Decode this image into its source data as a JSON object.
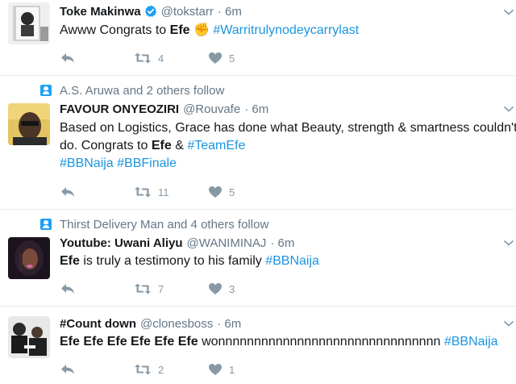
{
  "tweets": [
    {
      "name": "Toke Makinwa",
      "verified": true,
      "handle": "@tokstarr",
      "time": "· 6m",
      "lines": [
        [
          {
            "t": "Awww Congrats to ",
            "s": "n"
          },
          {
            "t": "Efe",
            "s": "b"
          },
          {
            "t": " ✊ ",
            "s": "n"
          },
          {
            "t": "#Warritrulynodeycarrylast",
            "s": "h"
          }
        ]
      ],
      "retweets": "4",
      "likes": "5",
      "avatar_colors": [
        "#d9d9d9",
        "#2b2b2b"
      ]
    },
    {
      "context": "A.S. Aruwa and 2 others follow",
      "name": "FAVOUR ONYEOZIRI",
      "verified": false,
      "handle": "@Rouvafe",
      "time": "· 6m",
      "lines": [
        [
          {
            "t": "Based on Logistics, Grace has done what Beauty, strength & smartness couldn't",
            "s": "n"
          }
        ],
        [
          {
            "t": "do. Congrats to ",
            "s": "n"
          },
          {
            "t": "Efe",
            "s": "b"
          },
          {
            "t": " & ",
            "s": "n"
          },
          {
            "t": "#TeamEfe",
            "s": "h"
          }
        ],
        [
          {
            "t": "#BBNaija",
            "s": "h"
          },
          {
            "t": " ",
            "s": "n"
          },
          {
            "t": "#BBFinale",
            "s": "h"
          }
        ]
      ],
      "retweets": "11",
      "likes": "5",
      "avatar_colors": [
        "#e9b94a",
        "#3a2a1d"
      ]
    },
    {
      "context": "Thirst Delivery Man and 4 others follow",
      "name": "Youtube: Uwani Aliyu",
      "verified": false,
      "handle": "@WANIMINAJ",
      "time": "· 6m",
      "lines": [
        [
          {
            "t": "Efe",
            "s": "b"
          },
          {
            "t": " is truly a testimony to his family ",
            "s": "n"
          },
          {
            "t": "#BBNaija",
            "s": "h"
          }
        ]
      ],
      "retweets": "7",
      "likes": "3",
      "avatar_colors": [
        "#1a1020",
        "#d46aa8"
      ]
    },
    {
      "name": "#Count down",
      "verified": false,
      "handle": "@clonesboss",
      "time": "· 6m",
      "lines": [
        [
          {
            "t": "Efe Efe Efe Efe Efe Efe",
            "s": "b"
          },
          {
            "t": " wonnnnnnnnnnnnnnnnnnnnnnnnnnnnnnn ",
            "s": "n"
          },
          {
            "t": "#BBNaija",
            "s": "h"
          }
        ]
      ],
      "retweets": "2",
      "likes": "1",
      "avatar_colors": [
        "#1c1c1c",
        "#f2f2f2"
      ]
    }
  ],
  "colors": {
    "hashtag": "#1b95e0",
    "meta": "#657786",
    "icon": "#8899a6",
    "verified": "#1da1f2"
  },
  "icons": {
    "reply": "reply-icon",
    "retweet": "retweet-icon",
    "like": "heart-icon",
    "menu": "chevron-down-icon",
    "context": "follow-context-icon",
    "verified": "verified-badge-icon"
  }
}
